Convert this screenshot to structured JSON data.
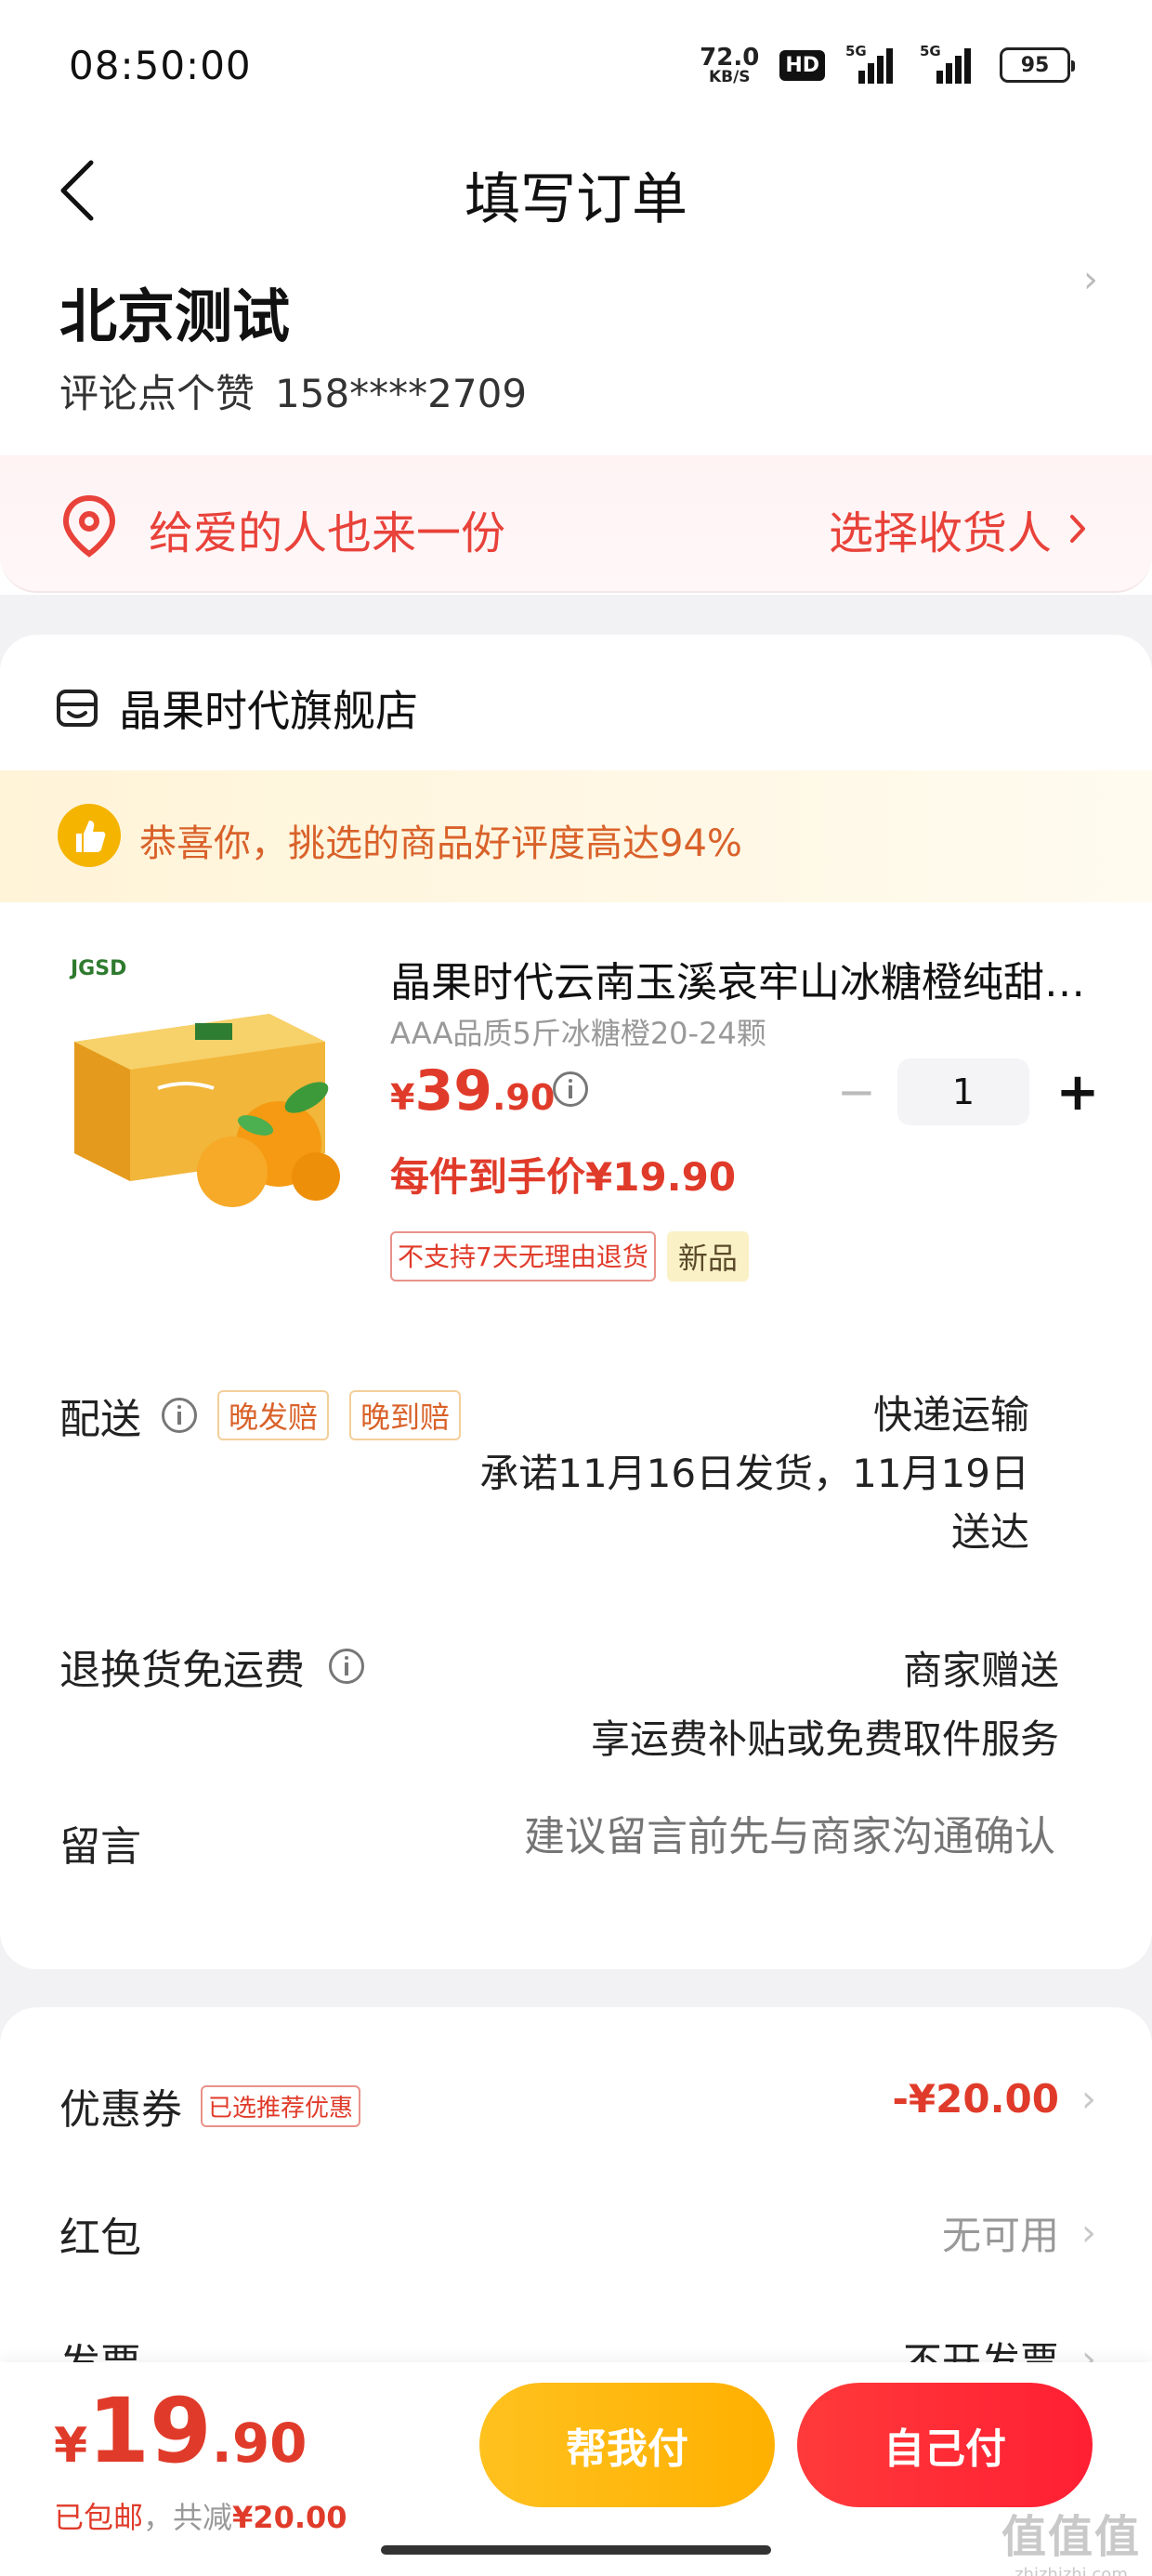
{
  "status_bar": {
    "time": "08:50:00",
    "net_speed_value": "72.0",
    "net_speed_unit": "KB/S",
    "hd": "HD",
    "sig1": "5G",
    "sig2": "5G",
    "battery": "95"
  },
  "nav": {
    "title": "填写订单"
  },
  "address": {
    "name": "北京测试",
    "contact_name": "评论点个赞",
    "phone": "158****2709"
  },
  "gift": {
    "text": "给爱的人也来一份",
    "action": "选择收货人"
  },
  "store": {
    "name": "晶果时代旗舰店",
    "praise": "恭喜你，挑选的商品好评度高达94%",
    "product": {
      "image_brand": "JGSD",
      "title": "晶果时代云南玉溪哀牢山冰糖橙纯甜新鲜水果",
      "spec": "AAA品质5斤冰糖橙20-24颗",
      "price_symbol": "¥",
      "price_int": "39",
      "price_dec": ".90",
      "quantity": "1",
      "unit_price": "每件到手价¥19.90",
      "tag_no_return": "不支持7天无理由退货",
      "tag_new": "新品"
    },
    "delivery": {
      "label": "配送",
      "tag_late_ship": "晚发赔",
      "tag_late_arrive": "晚到赔",
      "method": "快递运输",
      "promise": "承诺11月16日发货，11月19日送达"
    },
    "return_shipping": {
      "label": "退换货免运费",
      "value": "商家赠送",
      "desc": "享运费补贴或免费取件服务"
    },
    "message": {
      "label": "留言",
      "placeholder": "建议留言前先与商家沟通确认"
    }
  },
  "discounts": {
    "coupon_label": "优惠券",
    "coupon_tag": "已选推荐优惠",
    "coupon_value": "-¥20.00",
    "redpacket_label": "红包",
    "redpacket_value": "无可用",
    "invoice_label": "发票",
    "invoice_value": "不开发票"
  },
  "bottom": {
    "total_symbol": "¥",
    "total_int": "19",
    "total_dec": ".90",
    "free_ship": "已包邮",
    "reduced_prefix": "，共减",
    "reduced_amount": "¥20.00",
    "help_pay": "帮我付",
    "self_pay": "自己付"
  },
  "watermark": {
    "line1": "值值值",
    "line2": "zhizhizhi.com"
  }
}
